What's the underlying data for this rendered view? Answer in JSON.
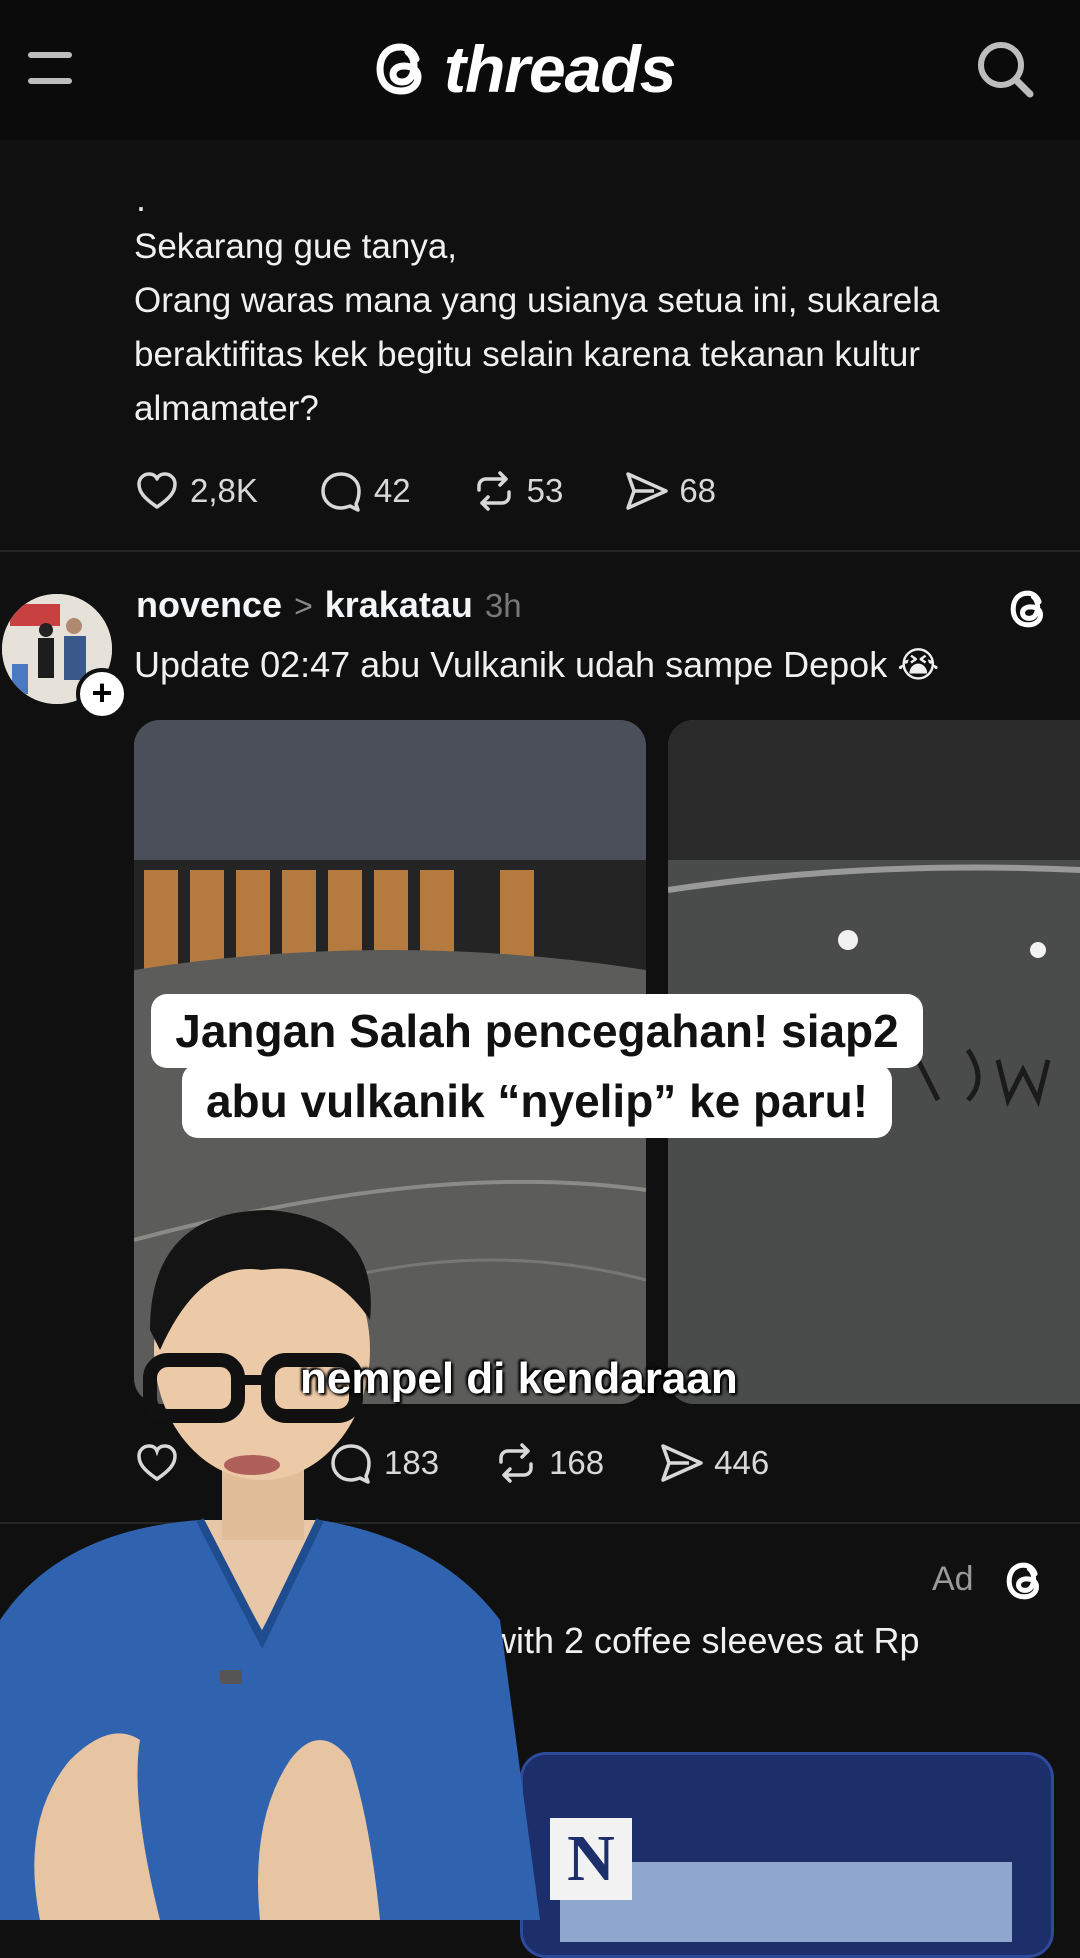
{
  "header": {
    "brand": "threads",
    "menu_icon": "hamburger-menu-icon",
    "search_icon": "search-icon"
  },
  "post1": {
    "ellipsis_line": ".",
    "lines": [
      "Sekarang gue tanya,",
      "Orang waras mana yang usianya setua ini, sukarela",
      "beraktifitas kek begitu selain karena tekanan kultur",
      "almamater?"
    ],
    "likes": "2,8K",
    "replies": "42",
    "reposts": "53",
    "shares": "68"
  },
  "post2": {
    "username": "novence",
    "separator": ">",
    "community": "krakatau",
    "time": "3h",
    "text": "Update 02:47 abu Vulkanik udah sampe Depok 😭",
    "replies": "183",
    "reposts": "168",
    "shares": "446"
  },
  "video_overlay": {
    "caption_line1": "Jangan Salah pencegahan! siap2",
    "caption_line2": "abu vulkanik “nyelip” ke paru!",
    "subtitle": "nempel di kendaraan"
  },
  "ad_post": {
    "label": "Ad",
    "text": "with 2 coffee sleeves at Rp",
    "logo_letter": "N"
  },
  "colors": {
    "background": "#101010",
    "text": "#f3f5f7",
    "muted": "#777777",
    "scrubs": "#2f63b0"
  }
}
